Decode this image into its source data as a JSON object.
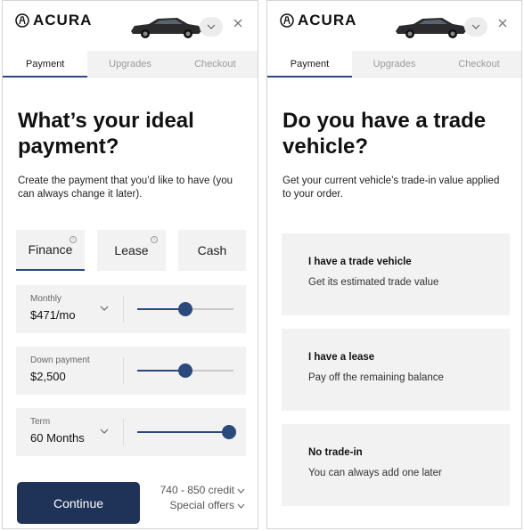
{
  "brand": {
    "name": "ACURA"
  },
  "tabs": [
    "Payment",
    "Upgrades",
    "Checkout"
  ],
  "left": {
    "title": "What’s your ideal payment?",
    "subtitle": "Create the payment that you’d like to have (you can always change it later).",
    "payment_types": [
      {
        "label": "Finance",
        "active": true,
        "info": true
      },
      {
        "label": "Lease",
        "active": false,
        "info": true
      },
      {
        "label": "Cash",
        "active": false,
        "info": false
      }
    ],
    "sliders": [
      {
        "label": "Monthly",
        "value": "$471/mo",
        "dropdown": true,
        "level": 0.5
      },
      {
        "label": "Down payment",
        "value": "$2,500",
        "dropdown": false,
        "level": 0.5
      },
      {
        "label": "Term",
        "value": "60 Months",
        "dropdown": true,
        "level": 0.95
      }
    ],
    "continue_label": "Continue",
    "credit_label": "740 - 850 credit",
    "offers_label": "Special offers"
  },
  "right": {
    "title": "Do you have a trade vehicle?",
    "subtitle": "Get your current vehicle’s trade-in value applied to your order.",
    "options": [
      {
        "title": "I have a trade vehicle",
        "desc": "Get its estimated trade value"
      },
      {
        "title": "I have a lease",
        "desc": "Pay off the remaining balance"
      },
      {
        "title": "No trade-in",
        "desc": "You can always add one later"
      }
    ]
  },
  "colors": {
    "accent": "#2a4a7d",
    "button": "#1f3258",
    "card": "#f2f2f2"
  }
}
